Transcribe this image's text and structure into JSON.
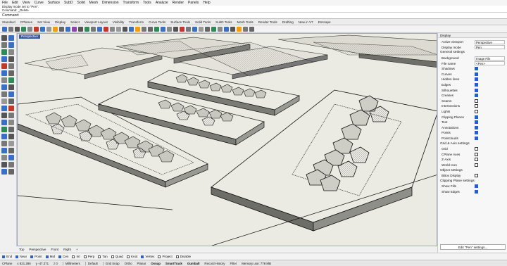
{
  "menu": [
    "File",
    "Edit",
    "View",
    "Curve",
    "Surface",
    "SubD",
    "Solid",
    "Mesh",
    "Dimension",
    "Transform",
    "Tools",
    "Analyze",
    "Render",
    "Panels",
    "Help"
  ],
  "command_history": [
    "Display mode set to \"Pen\".",
    "Command: _Delete"
  ],
  "command_prompt": "Command:",
  "toolbar_tabs": [
    "Standard",
    "CPlanes",
    "Set View",
    "Display",
    "Select",
    "Viewport Layout",
    "Visibility",
    "Transform",
    "Curve Tools",
    "Surface Tools",
    "Solid Tools",
    "SubD Tools",
    "Mesh Tools",
    "Render Tools",
    "Drafting",
    "New in V7",
    "Enscape"
  ],
  "viewport": {
    "label": "Perspective",
    "tabs": [
      "Top",
      "Perspective",
      "Front",
      "Right",
      "+"
    ]
  },
  "osnaps": [
    {
      "label": "End",
      "on": true
    },
    {
      "label": "Near",
      "on": true
    },
    {
      "label": "Point",
      "on": true
    },
    {
      "label": "Mid",
      "on": true
    },
    {
      "label": "Cen",
      "on": true
    },
    {
      "label": "Int",
      "on": false
    },
    {
      "label": "Perp",
      "on": false
    },
    {
      "label": "Tan",
      "on": false
    },
    {
      "label": "Quad",
      "on": false
    },
    {
      "label": "Knot",
      "on": false
    },
    {
      "label": "Vertex",
      "on": true
    },
    {
      "label": "Project",
      "on": false
    },
    {
      "label": "Disable",
      "on": false
    }
  ],
  "status": {
    "cplane": "CPlane",
    "x": "x 821.286",
    "y": "y -47.371",
    "z": "z 0",
    "units": "Millimeters",
    "layer": "Default",
    "grid_snap": "Grid Snap",
    "ortho": "Ortho",
    "planar": "Planar",
    "osnap": "Osnap",
    "smarttrack": "SmartTrack",
    "gumball": "Gumball",
    "record_history": "Record History",
    "filter": "Filter",
    "memory": "Memory use: 778 MB"
  },
  "panel": {
    "title": "Display",
    "rows": [
      {
        "type": "field",
        "label": "Active viewport",
        "value": "Perspective"
      },
      {
        "type": "field",
        "label": "Display mode",
        "value": "Pen"
      },
      {
        "type": "section",
        "label": "General settings"
      },
      {
        "type": "field",
        "label": "Background",
        "value": "Image File"
      },
      {
        "type": "field",
        "label": "File name",
        "value": "<Pen>"
      },
      {
        "type": "check",
        "label": "Shadows",
        "on": true
      },
      {
        "type": "check",
        "label": "Curves",
        "on": true
      },
      {
        "type": "check",
        "label": "Hidden lines",
        "on": true
      },
      {
        "type": "check",
        "label": "Edges",
        "on": true
      },
      {
        "type": "check",
        "label": "Silhouettes",
        "on": true
      },
      {
        "type": "check",
        "label": "Creases",
        "on": true
      },
      {
        "type": "check",
        "label": "Seams",
        "on": false
      },
      {
        "type": "check",
        "label": "Intersections",
        "on": false
      },
      {
        "type": "check",
        "label": "Lights",
        "on": false
      },
      {
        "type": "check",
        "label": "Clipping Planes",
        "on": true
      },
      {
        "type": "check",
        "label": "Text",
        "on": true
      },
      {
        "type": "check",
        "label": "Annotations",
        "on": true
      },
      {
        "type": "check",
        "label": "Points",
        "on": true
      },
      {
        "type": "check",
        "label": "Pointclouds",
        "on": true
      },
      {
        "type": "section",
        "label": "Grid & Axis settings"
      },
      {
        "type": "check",
        "label": "Grid",
        "on": false
      },
      {
        "type": "check",
        "label": "CPlane Axes",
        "on": false
      },
      {
        "type": "check",
        "label": "Z-Axis",
        "on": false
      },
      {
        "type": "check",
        "label": "World Icon",
        "on": false
      },
      {
        "type": "section",
        "label": "Object settings"
      },
      {
        "type": "check",
        "label": "BBox Display",
        "on": false
      },
      {
        "type": "section",
        "label": "Clipping Plane settings"
      },
      {
        "type": "check",
        "label": "Show Fills",
        "on": true
      },
      {
        "type": "check",
        "label": "Show Edges",
        "on": true
      }
    ],
    "edit_button": "Edit \"Pen\" settings..."
  }
}
